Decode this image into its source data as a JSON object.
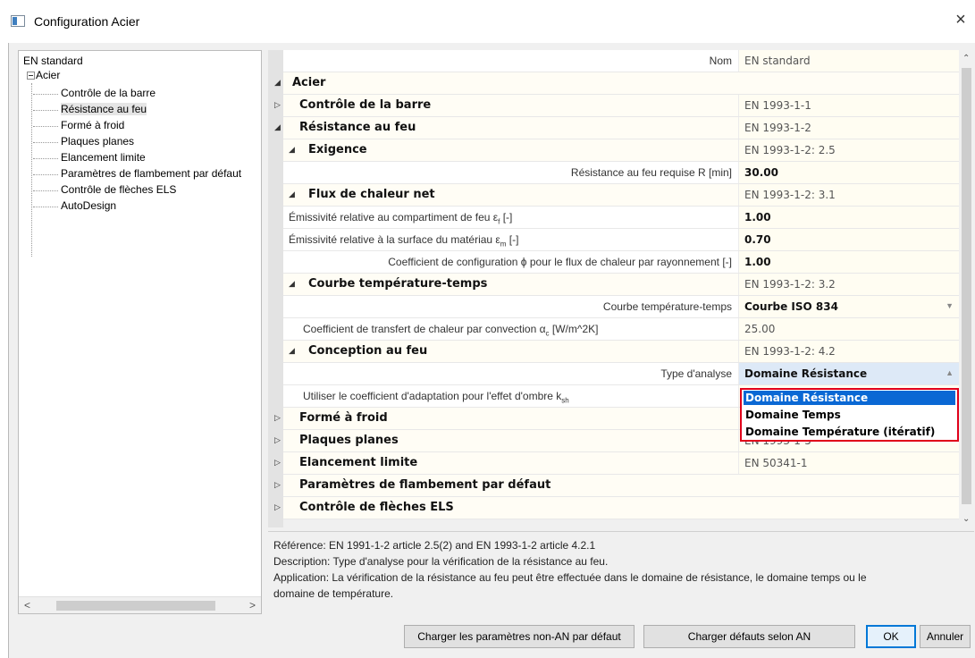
{
  "window": {
    "title": "Configuration Acier",
    "close_glyph": "×"
  },
  "tree": {
    "root": "EN standard",
    "acier": "Acier",
    "children": [
      "Contrôle de la barre",
      "Résistance au feu",
      "Formé à froid",
      "Plaques planes",
      "Elancement limite",
      "Paramètres de flambement par défaut",
      "Contrôle de flèches ELS",
      "AutoDesign"
    ],
    "selected_index": 1,
    "scroll_left": "<",
    "scroll_right": ">"
  },
  "grid": {
    "nom_label": "Nom",
    "nom_value": "EN standard",
    "acier": "Acier",
    "controle_barre": {
      "label": "Contrôle de la barre",
      "value": "EN 1993-1-1"
    },
    "resistance_feu": {
      "label": "Résistance au feu",
      "value": "EN 1993-1-2"
    },
    "exigence": {
      "label": "Exigence",
      "value": "EN 1993-1-2: 2.5"
    },
    "resistance_requise": {
      "label": "Résistance au feu requise R [min]",
      "value": "30.00"
    },
    "flux": {
      "label": "Flux de chaleur net",
      "value": "EN 1993-1-2: 3.1"
    },
    "emissivite_f": {
      "label": "Émissivité relative au compartiment de feu ε",
      "sub": "f",
      "unit": " [-]",
      "value": "1.00"
    },
    "emissivite_m": {
      "label": "Émissivité relative à la surface du matériau ε",
      "sub": "m",
      "unit": " [-]",
      "value": "0.70"
    },
    "coef_config": {
      "label": "Coefficient de configuration ϕ pour le flux de chaleur par rayonnement [-]",
      "value": "1.00"
    },
    "courbe": {
      "label": "Courbe température-temps",
      "value": "EN 1993-1-2: 3.2"
    },
    "courbe_select": {
      "label": "Courbe température-temps",
      "value": "Courbe ISO 834"
    },
    "coef_transfert": {
      "label": "Coefficient de transfert de chaleur par convection α",
      "sub": "c",
      "unit": " [W/m^2K]",
      "value": "25.00"
    },
    "conception": {
      "label": "Conception au feu",
      "value": "EN 1993-1-2: 4.2"
    },
    "type_analyse": {
      "label": "Type d'analyse",
      "value": "Domaine Résistance"
    },
    "ombre": {
      "label": "Utiliser le coefficient d'adaptation pour l'effet d'ombre k",
      "sub": "sh"
    },
    "forme_froid": {
      "label": "Formé à froid"
    },
    "plaques": {
      "label": "Plaques planes",
      "value": "EN 1993-1-5"
    },
    "elancement": {
      "label": "Elancement limite",
      "value": "EN 50341-1"
    },
    "flambement": {
      "label": "Paramètres de flambement par défaut"
    },
    "fleches": {
      "label": "Contrôle de flèches ELS"
    },
    "tri_open": "◢",
    "tri_closed": "▷"
  },
  "dropdown": {
    "options": [
      "Domaine Résistance",
      "Domaine Temps",
      "Domaine Température (itératif)"
    ],
    "selected_index": 0
  },
  "description": {
    "line1": "Référence: EN 1991-1-2 article 2.5(2) and EN 1993-1-2 article 4.2.1",
    "line2": "Description: Type d'analyse pour la vérification de la résistance au feu.",
    "line3": "Application: La vérification de la résistance au feu peut être effectuée dans le domaine de résistance, le domaine temps ou le",
    "line4": "domaine de température."
  },
  "buttons": {
    "load_non_an": "Charger les paramètres non-AN par défaut",
    "load_an": "Charger défauts selon AN",
    "ok": "OK",
    "cancel": "Annuler"
  },
  "colors": {
    "accent": "#0a68d4",
    "highlight_border": "#e0001a"
  }
}
